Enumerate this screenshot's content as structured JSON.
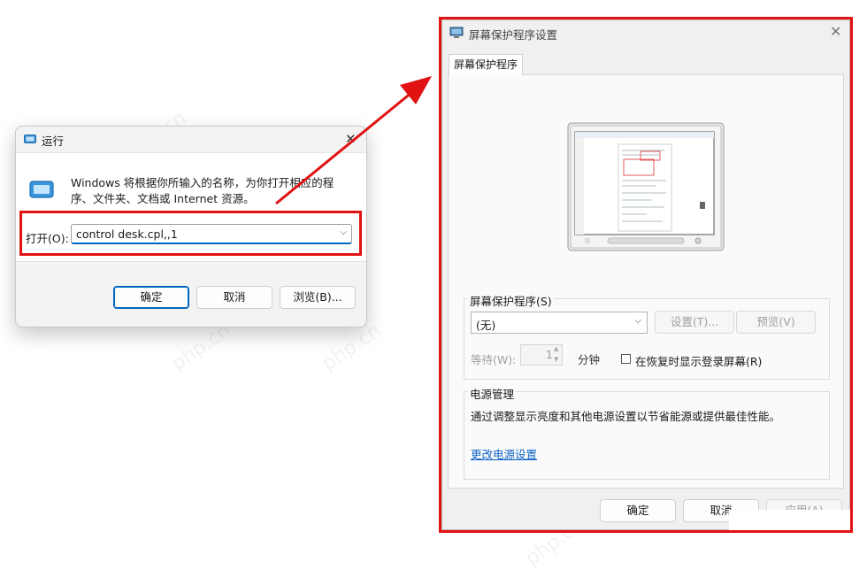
{
  "run_dialog": {
    "title": "运行",
    "description": "Windows 将根据你所输入的名称，为你打开相应的程序、文件夹、文档或 Internet 资源。",
    "open_label": "打开(O):",
    "command_value": "control desk.cpl,,1",
    "ok_label": "确定",
    "cancel_label": "取消",
    "browse_label": "浏览(B)..."
  },
  "screensaver_dialog": {
    "title": "屏幕保护程序设置",
    "tab_label": "屏幕保护程序",
    "screensaver_group_label": "屏幕保护程序(S)",
    "screensaver_selected": "(无)",
    "settings_label": "设置(T)...",
    "preview_label": "预览(V)",
    "wait_label": "等待(W):",
    "wait_value": "1",
    "minutes_label": "分钟",
    "resume_checkbox_label": "在恢复时显示登录屏幕(R)",
    "resume_checked": false,
    "power_group_label": "电源管理",
    "power_description": "通过调整显示亮度和其他电源设置以节省能源或提供最佳性能。",
    "change_power_link": "更改电源设置",
    "ok_label": "确定",
    "cancel_label": "取消",
    "apply_label": "应用(A)"
  },
  "annotations": {
    "highlight_color": "#e01212"
  },
  "watermark_text": "php.cn"
}
